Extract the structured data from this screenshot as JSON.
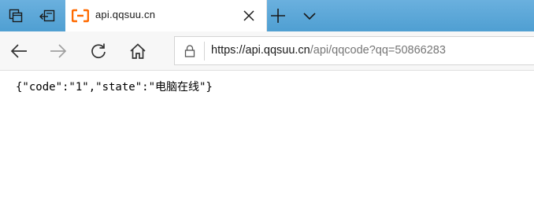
{
  "tabbar": {
    "left_icons": [
      "tabs-aside-icon",
      "set-aside-tabs-icon"
    ],
    "active_tab": {
      "favicon": "bracket-favicon-icon",
      "title": "api.qqsuu.cn",
      "close_icon": "close-icon"
    },
    "new_tab_icon": "plus-icon",
    "tab_list_icon": "chevron-down-icon"
  },
  "navbar": {
    "back_icon": "arrow-left-icon",
    "forward_icon": "arrow-right-icon",
    "refresh_icon": "refresh-icon",
    "home_icon": "home-icon",
    "address": {
      "lock_icon": "lock-icon",
      "url_host": "https://api.qqsuu.cn",
      "url_path": "/api/qqcode?qq=50866283"
    }
  },
  "content": {
    "body_text": "{\"code\":\"1\",\"state\":\"电脑在线\"}"
  },
  "colors": {
    "tabbar_bg": "#5aa6d8",
    "favicon_orange": "#ff6a00",
    "icon_gray": "#333333",
    "icon_disabled": "#a0a0a0"
  }
}
